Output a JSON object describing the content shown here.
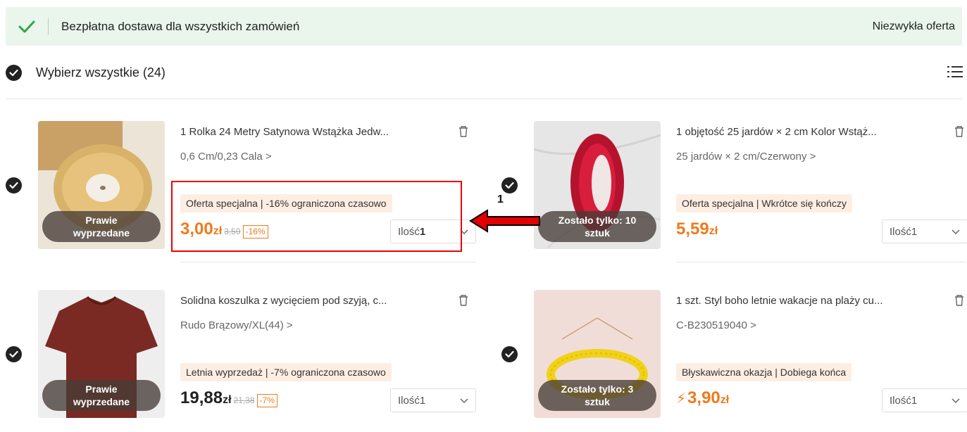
{
  "banner": {
    "text": "Bezpłatna dostawa dla wszystkich zamówień",
    "link": "Niezwykła oferta"
  },
  "select_all": {
    "label": "Wybierz wszystkie (24)"
  },
  "annotation": {
    "label": "1"
  },
  "items": [
    {
      "title": "1 Rolka 24 Metry Satynowa Wstążka Jedw...",
      "variant": "0,6 Cm/0,23 Cala >",
      "image_tag": "Prawie\nwyprzedane",
      "promo": "Oferta specjalna | -16% ograniczona czasowo",
      "price": "3,00",
      "currency": "zł",
      "old_price": "3,59",
      "discount": "-16%",
      "qty_label": "Ilość",
      "qty_value": "1"
    },
    {
      "title": "1 objętość 25 jardów × 2 cm Kolor Wstąż...",
      "variant": "25 jardów × 2 cm/Czerwony >",
      "image_tag": "Zostało tylko: 10\nsztuk",
      "promo": "Oferta specjalna | Wkrótce się kończy",
      "price": "5,59",
      "currency": "zł",
      "qty_label": "Ilość",
      "qty_value": "1"
    },
    {
      "title": "Solidna koszulka z wycięciem pod szyją, c...",
      "variant": "Rudo Brązowy/XL(44) >",
      "image_tag": "Prawie\nwyprzedane",
      "promo": "Letnia wyprzedaż | -7% ograniczona czasowo",
      "price": "19,88",
      "currency": "zł",
      "old_price": "21,38",
      "discount": "-7%",
      "qty_label": "Ilość",
      "qty_value": "1"
    },
    {
      "title": "1 szt. Styl boho letnie wakacje na plaży cu...",
      "variant": "C-B230519040 >",
      "image_tag": "Zostało tylko: 3\nsztuk",
      "promo": "Błyskawiczna okazja | Dobiega końca",
      "price": "3,90",
      "currency": "zł",
      "qty_label": "Ilość",
      "qty_value": "1"
    }
  ],
  "colors": {
    "accent": "#f07a1c",
    "banner_bg": "#eaf6ec",
    "check_green": "#2ea44f",
    "annotation_red": "#e00000"
  }
}
